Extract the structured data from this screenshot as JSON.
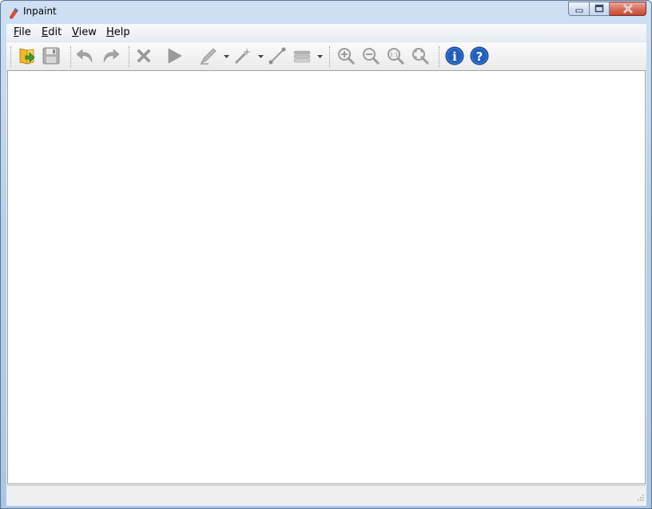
{
  "window": {
    "title": "Inpaint",
    "controls": {
      "minimize": "minimize",
      "maximize": "maximize",
      "close": "close"
    }
  },
  "menu": [
    {
      "label": "File",
      "accel": "F",
      "rest": "ile"
    },
    {
      "label": "Edit",
      "accel": "E",
      "rest": "dit"
    },
    {
      "label": "View",
      "accel": "V",
      "rest": "iew"
    },
    {
      "label": "Help",
      "accel": "H",
      "rest": "elp"
    }
  ],
  "toolbar": {
    "icons": [
      "open-icon",
      "save-icon",
      "undo-icon",
      "redo-icon",
      "delete-icon",
      "run-icon",
      "pencil-icon",
      "magic-wand-icon",
      "line-icon",
      "layers-icon",
      "zoom-in-icon",
      "zoom-out-icon",
      "zoom-actual-icon",
      "zoom-fit-icon",
      "info-icon",
      "help-icon"
    ],
    "zoom_actual_text": "1:1",
    "info_glyph": "i",
    "help_glyph": "?"
  },
  "colors": {
    "accent_blue": "#1e5fbf",
    "open_green": "#3f9b2f",
    "open_yellow": "#f3b829",
    "disabled_gray": "#9b9b9b"
  }
}
